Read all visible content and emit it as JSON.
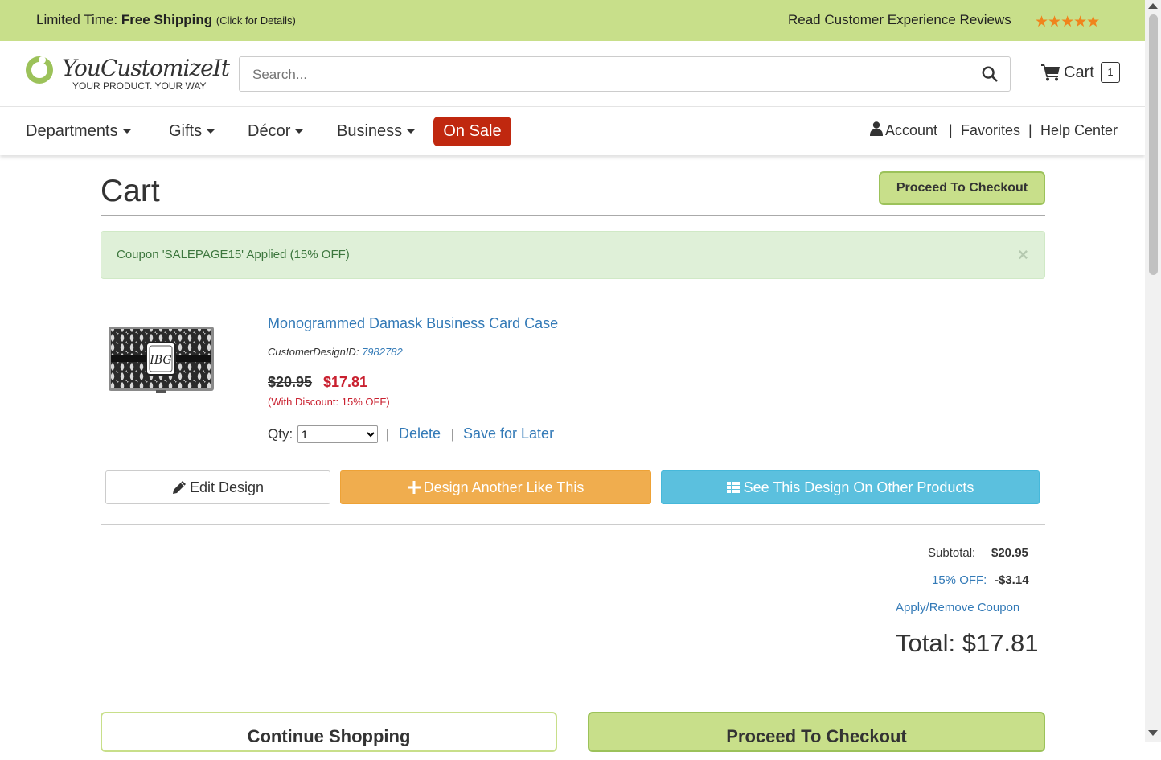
{
  "promo": {
    "prefix": "Limited Time: ",
    "highlight": "Free Shipping",
    "suffix": "(Click for Details)",
    "reviews_label": "Read Customer Experience Reviews",
    "stars": "★★★★★"
  },
  "brand": {
    "name": "YouCustomizeIt",
    "tagline": "YOUR PRODUCT. YOUR WAY"
  },
  "search": {
    "placeholder": "Search..."
  },
  "cart": {
    "label": "Cart",
    "count": "1"
  },
  "nav": {
    "items": [
      {
        "label": "Departments"
      },
      {
        "label": "Gifts"
      },
      {
        "label": "Décor"
      },
      {
        "label": "Business"
      }
    ],
    "sale_label": "On Sale",
    "account": "Account",
    "favorites": "Favorites",
    "help": "Help Center",
    "separator": "|"
  },
  "page": {
    "title": "Cart",
    "checkout_label": "Proceed To Checkout"
  },
  "alert": {
    "message": "Coupon 'SALEPAGE15' Applied (15% OFF)",
    "close": "×"
  },
  "item": {
    "name": "Monogrammed Damask Business Card Case",
    "design_id_label": "CustomerDesignID:",
    "design_id": "7982782",
    "old_price": "$20.95",
    "new_price": "$17.81",
    "discount_note": "(With Discount: 15% OFF)",
    "monogram": "IBG",
    "qty_label": "Qty:",
    "qty_value": "1",
    "delete_label": "Delete",
    "save_later_label": "Save for Later",
    "edit_label": "Edit Design",
    "design_another_label": "Design Another Like This",
    "see_other_label": "See This Design On Other Products"
  },
  "summary": {
    "subtotal_label": "Subtotal:",
    "subtotal": "$20.95",
    "discount_label": "15% OFF:",
    "discount": "-$3.14",
    "coupon_link": "Apply/Remove Coupon",
    "total": "Total: $17.81"
  },
  "footer_buttons": {
    "continue": "Continue Shopping",
    "checkout": "Proceed To Checkout"
  },
  "colors": {
    "promo_bg": "#c8df8a",
    "sale_red": "#c0280f",
    "link_blue": "#337ab7",
    "price_red": "#c9202f",
    "orange": "#f0ad4e",
    "cyan": "#5bc0de"
  }
}
